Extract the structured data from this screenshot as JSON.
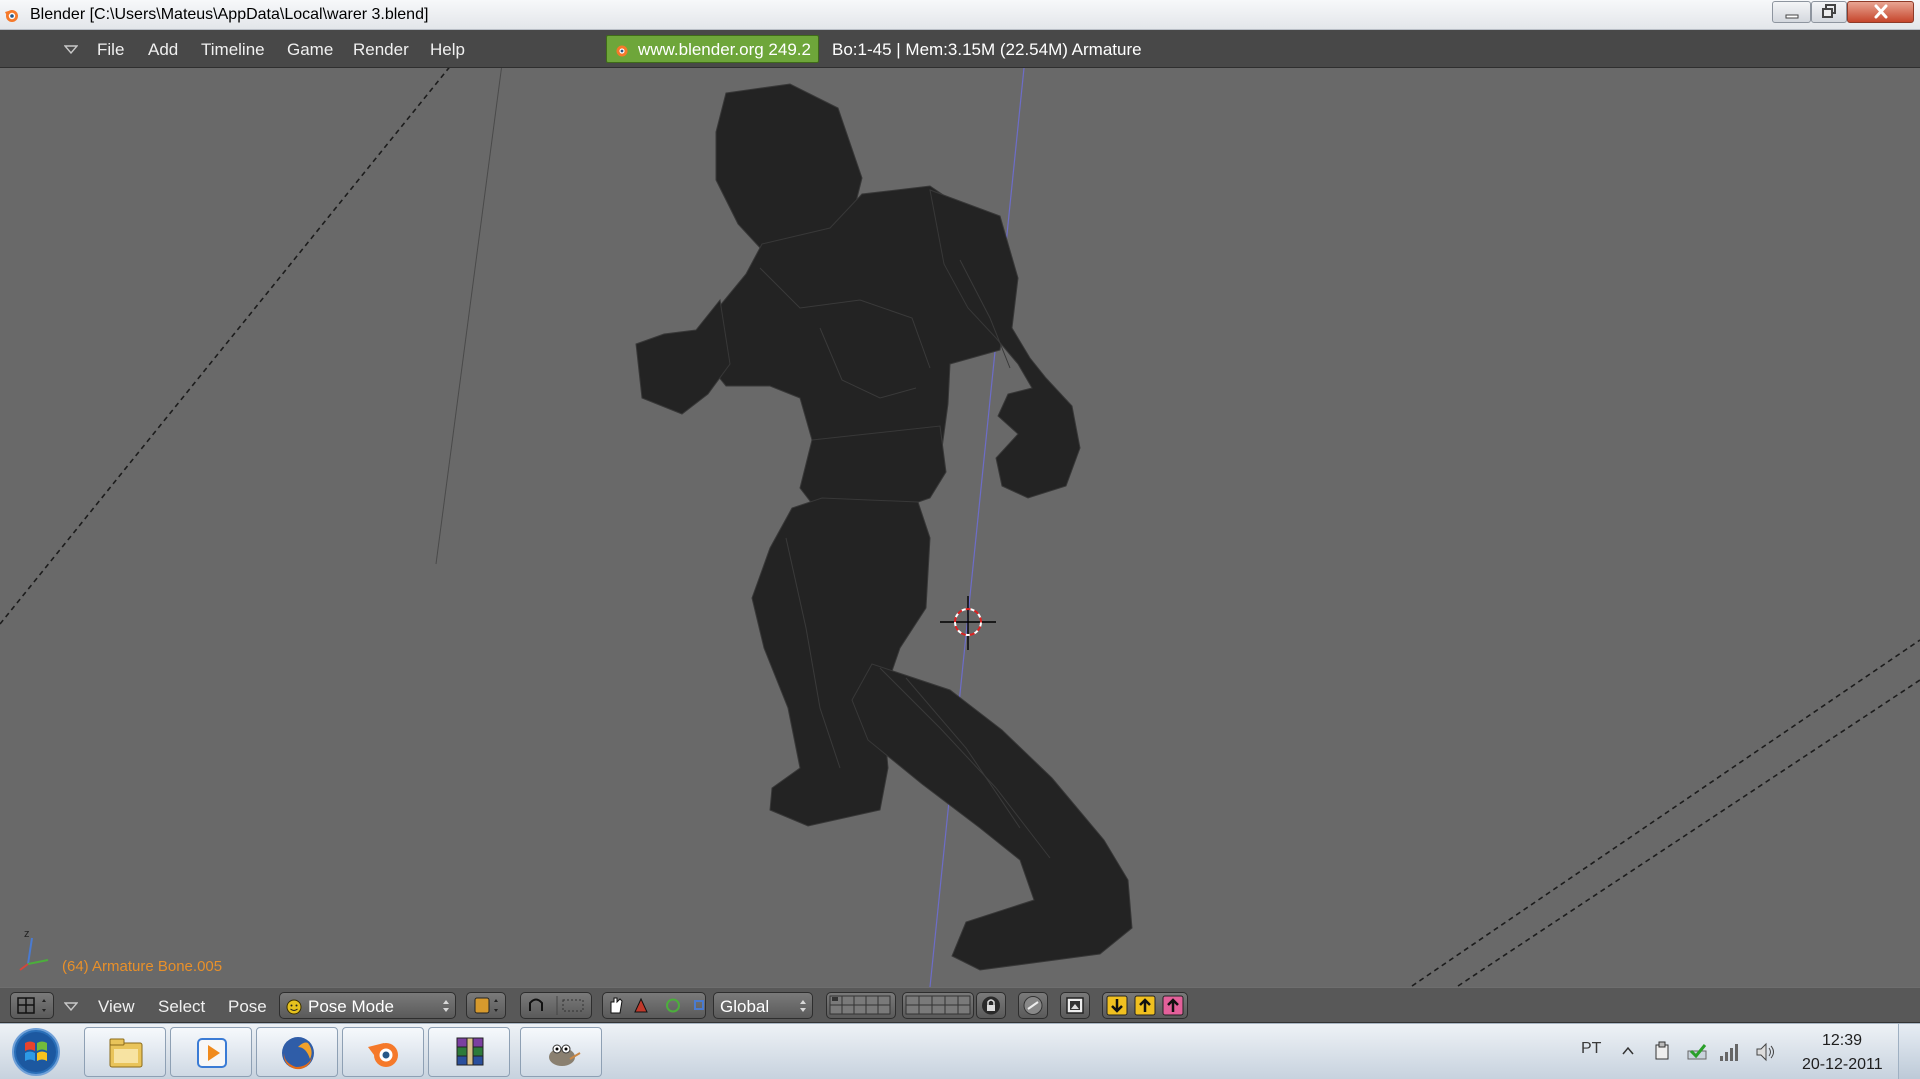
{
  "window": {
    "title": "Blender [C:\\Users\\Mateus\\AppData\\Local\\warer 3.blend]",
    "icons": {
      "app": "blender-icon",
      "minimize": "minimize-icon",
      "maximize": "restore-icon",
      "close": "close-icon"
    }
  },
  "info_header": {
    "menus": [
      "File",
      "Add",
      "Timeline",
      "Game",
      "Render",
      "Help"
    ],
    "url_badge": "www.blender.org 249.2",
    "stats": "Bo:1-45  | Mem:3.15M (22.54M) Armature",
    "accent_color": "#6ea63a"
  },
  "viewport": {
    "status_text": "(64) Armature Bone.005",
    "status_color": "#e8902a",
    "background_color": "#696969",
    "scene": "dark low-poly humanoid figure in pose mode with 3D cursor"
  },
  "viewport_header": {
    "menus": [
      "View",
      "Select",
      "Pose"
    ],
    "mode": "Pose Mode",
    "orientation": "Global",
    "icons": [
      "view-type-icon",
      "pose-mode-icon",
      "pivot-icon",
      "snap-icon",
      "grab-icon",
      "translate-icon",
      "rotate-icon",
      "scale-icon",
      "layers-icon",
      "lock-icon",
      "link-icon",
      "render-icon",
      "copy-pose-icon",
      "paste-pose-icon",
      "paste-flipped-icon"
    ]
  },
  "taskbar": {
    "apps": [
      "windows-explorer-icon",
      "media-player-icon",
      "firefox-icon",
      "blender-icon",
      "winrar-icon",
      "gimp-icon"
    ],
    "language": "PT",
    "time": "12:39",
    "date": "20-12-2011"
  }
}
